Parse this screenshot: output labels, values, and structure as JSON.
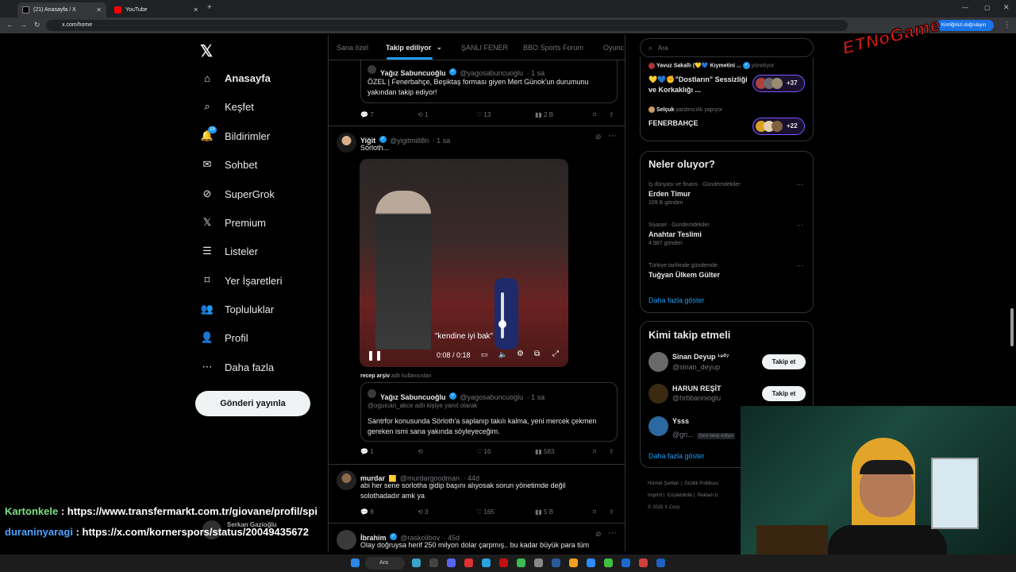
{
  "browser": {
    "tabs": [
      {
        "label": "(21) Anasayfa / X"
      },
      {
        "label": "YouTube"
      }
    ],
    "url": "x.com/home",
    "profile_label": "Kimliğinizi doğrulayın"
  },
  "nav": {
    "items": [
      {
        "label": "Anasayfa",
        "icon": "home-icon"
      },
      {
        "label": "Keşfet",
        "icon": "search-icon"
      },
      {
        "label": "Bildirimler",
        "icon": "bell-icon",
        "badge": "15"
      },
      {
        "label": "Sohbet",
        "icon": "mail-icon"
      },
      {
        "label": "SuperGrok",
        "icon": "grok-icon"
      },
      {
        "label": "Premium",
        "icon": "x-icon"
      },
      {
        "label": "Listeler",
        "icon": "list-icon"
      },
      {
        "label": "Yer İşaretleri",
        "icon": "bookmark-icon"
      },
      {
        "label": "Topluluklar",
        "icon": "people-icon"
      },
      {
        "label": "Profil",
        "icon": "person-icon"
      },
      {
        "label": "Daha fazla",
        "icon": "more-icon"
      }
    ],
    "post_button": "Gönderi yayınla"
  },
  "timeline": {
    "tabs": [
      "Sana özel",
      "Takip ediliyor",
      "ŞANLI FENER",
      "BBO Sports Forum",
      "Oyunc"
    ],
    "tweet0": {
      "name": "Yağız Sabuncuoğlu",
      "handle": "@yagosabuncuoglu",
      "time": "· 1 sa",
      "text": "ÖZEL | Fenerbahçe, Beşiktaş forması giyen Mert Günok'un durumunu yakından takip ediyor!",
      "replies": "7",
      "reposts": "1",
      "likes": "13",
      "views": "2 B"
    },
    "tweet1": {
      "name": "Yiğit",
      "handle": "@yigitmilt8n",
      "time": "· 1 sa",
      "text": "Sörloth...",
      "video_caption": "\"kendine iyi bak\"",
      "video_time": "0:08 / 0:18",
      "attribution_name": "recep arşiv",
      "attribution_suffix": "adlı kullanıcıdan",
      "quote": {
        "name": "Yağız Sabuncuoğlu",
        "handle": "@yagosabuncuoglu",
        "time": "· 1 sa",
        "reply_to": "@oguican_akce adlı kişiye yanıt olarak",
        "text": "Santrfor konusunda Sörloth'a saplanıp takılı kalma, yeni mercek çekmen gereken ismi sana yakında söyleyeceğim."
      },
      "replies": "1",
      "reposts": "",
      "likes": "16",
      "views": "583"
    },
    "tweet2": {
      "name": "murdar",
      "handle": "@murdargoodman",
      "time": "· 44d",
      "text": "abi her sene sorlotha gidip başını alıyosak sorun yönetimde değil solothadadır amk ya",
      "replies": "8",
      "reposts": "3",
      "likes": "165",
      "views": "5 B"
    },
    "tweet3": {
      "name": "İbrahim",
      "handle": "@raskolibov",
      "time": "· 45d",
      "text": "Olay doğruysa herif 250 milyon dolar çarpmış.. bu kadar büyük para tüm"
    }
  },
  "right": {
    "search_placeholder": "Ara",
    "spaces": [
      {
        "host": "Yavuz Sakallı (💛💙 Kıymetini ...",
        "role": "yönetiyor",
        "title": "💛💙✊\"Dostların\" Sessizliği ve Korkaklığı ...",
        "count": "+37"
      },
      {
        "host": "Selçuk",
        "role": "yardımcılık yapıyor",
        "title": "FENERBAHÇE",
        "count": "+22"
      }
    ],
    "trends_title": "Neler oluyor?",
    "trends": [
      {
        "meta": "İş dünyası ve finans · Gündemdekiler",
        "name": "Erden Timur",
        "count": "109 B gönderi"
      },
      {
        "meta": "Siyaset · Gündemdekiler",
        "name": "Anahtar Teslimi",
        "count": "4.987 gönderi"
      },
      {
        "meta": "Türkiye tarihinde gündemde",
        "name": "Tuğyan Ülkem Gülter",
        "count": ""
      }
    ],
    "show_more": "Daha fazla göster",
    "who_title": "Kimi takip etmeli",
    "who": [
      {
        "name": "Sinan Deyup ¹⁹⁰⁷",
        "handle": "@sinan_deyup",
        "button": "Takip et"
      },
      {
        "name": "HARUN REŞİT",
        "handle": "@hrbbannioglu",
        "button": "Takip et"
      },
      {
        "name": "Ysss",
        "handle": "@gri...",
        "note": "Seni takip ediyor"
      }
    ],
    "footer": [
      "Hizmet Şartları",
      "Gizlilik Politikası",
      "Imprint",
      "Erişilebilirlik",
      "Reklam b",
      "© 2025 X Corp."
    ]
  },
  "overlay": {
    "logo": "ETNoGame",
    "chat": [
      {
        "user": "Kartonkele",
        "text": " : https://www.transfermarkt.com.tr/giovane/profil/spi"
      },
      {
        "user": "duraninyaragi",
        "text": " : https://x.com/kornerspors/status/20049435672"
      }
    ],
    "ghost_name": "Serkan Gazioğlu",
    "taskbar_search": "Ara"
  },
  "colors": {
    "accent": "#1d9bf0",
    "bg": "#000000",
    "border": "#2f3336",
    "muted": "#71767b",
    "chat_user1": "#7ee081",
    "chat_user2": "#4fa3ff"
  }
}
